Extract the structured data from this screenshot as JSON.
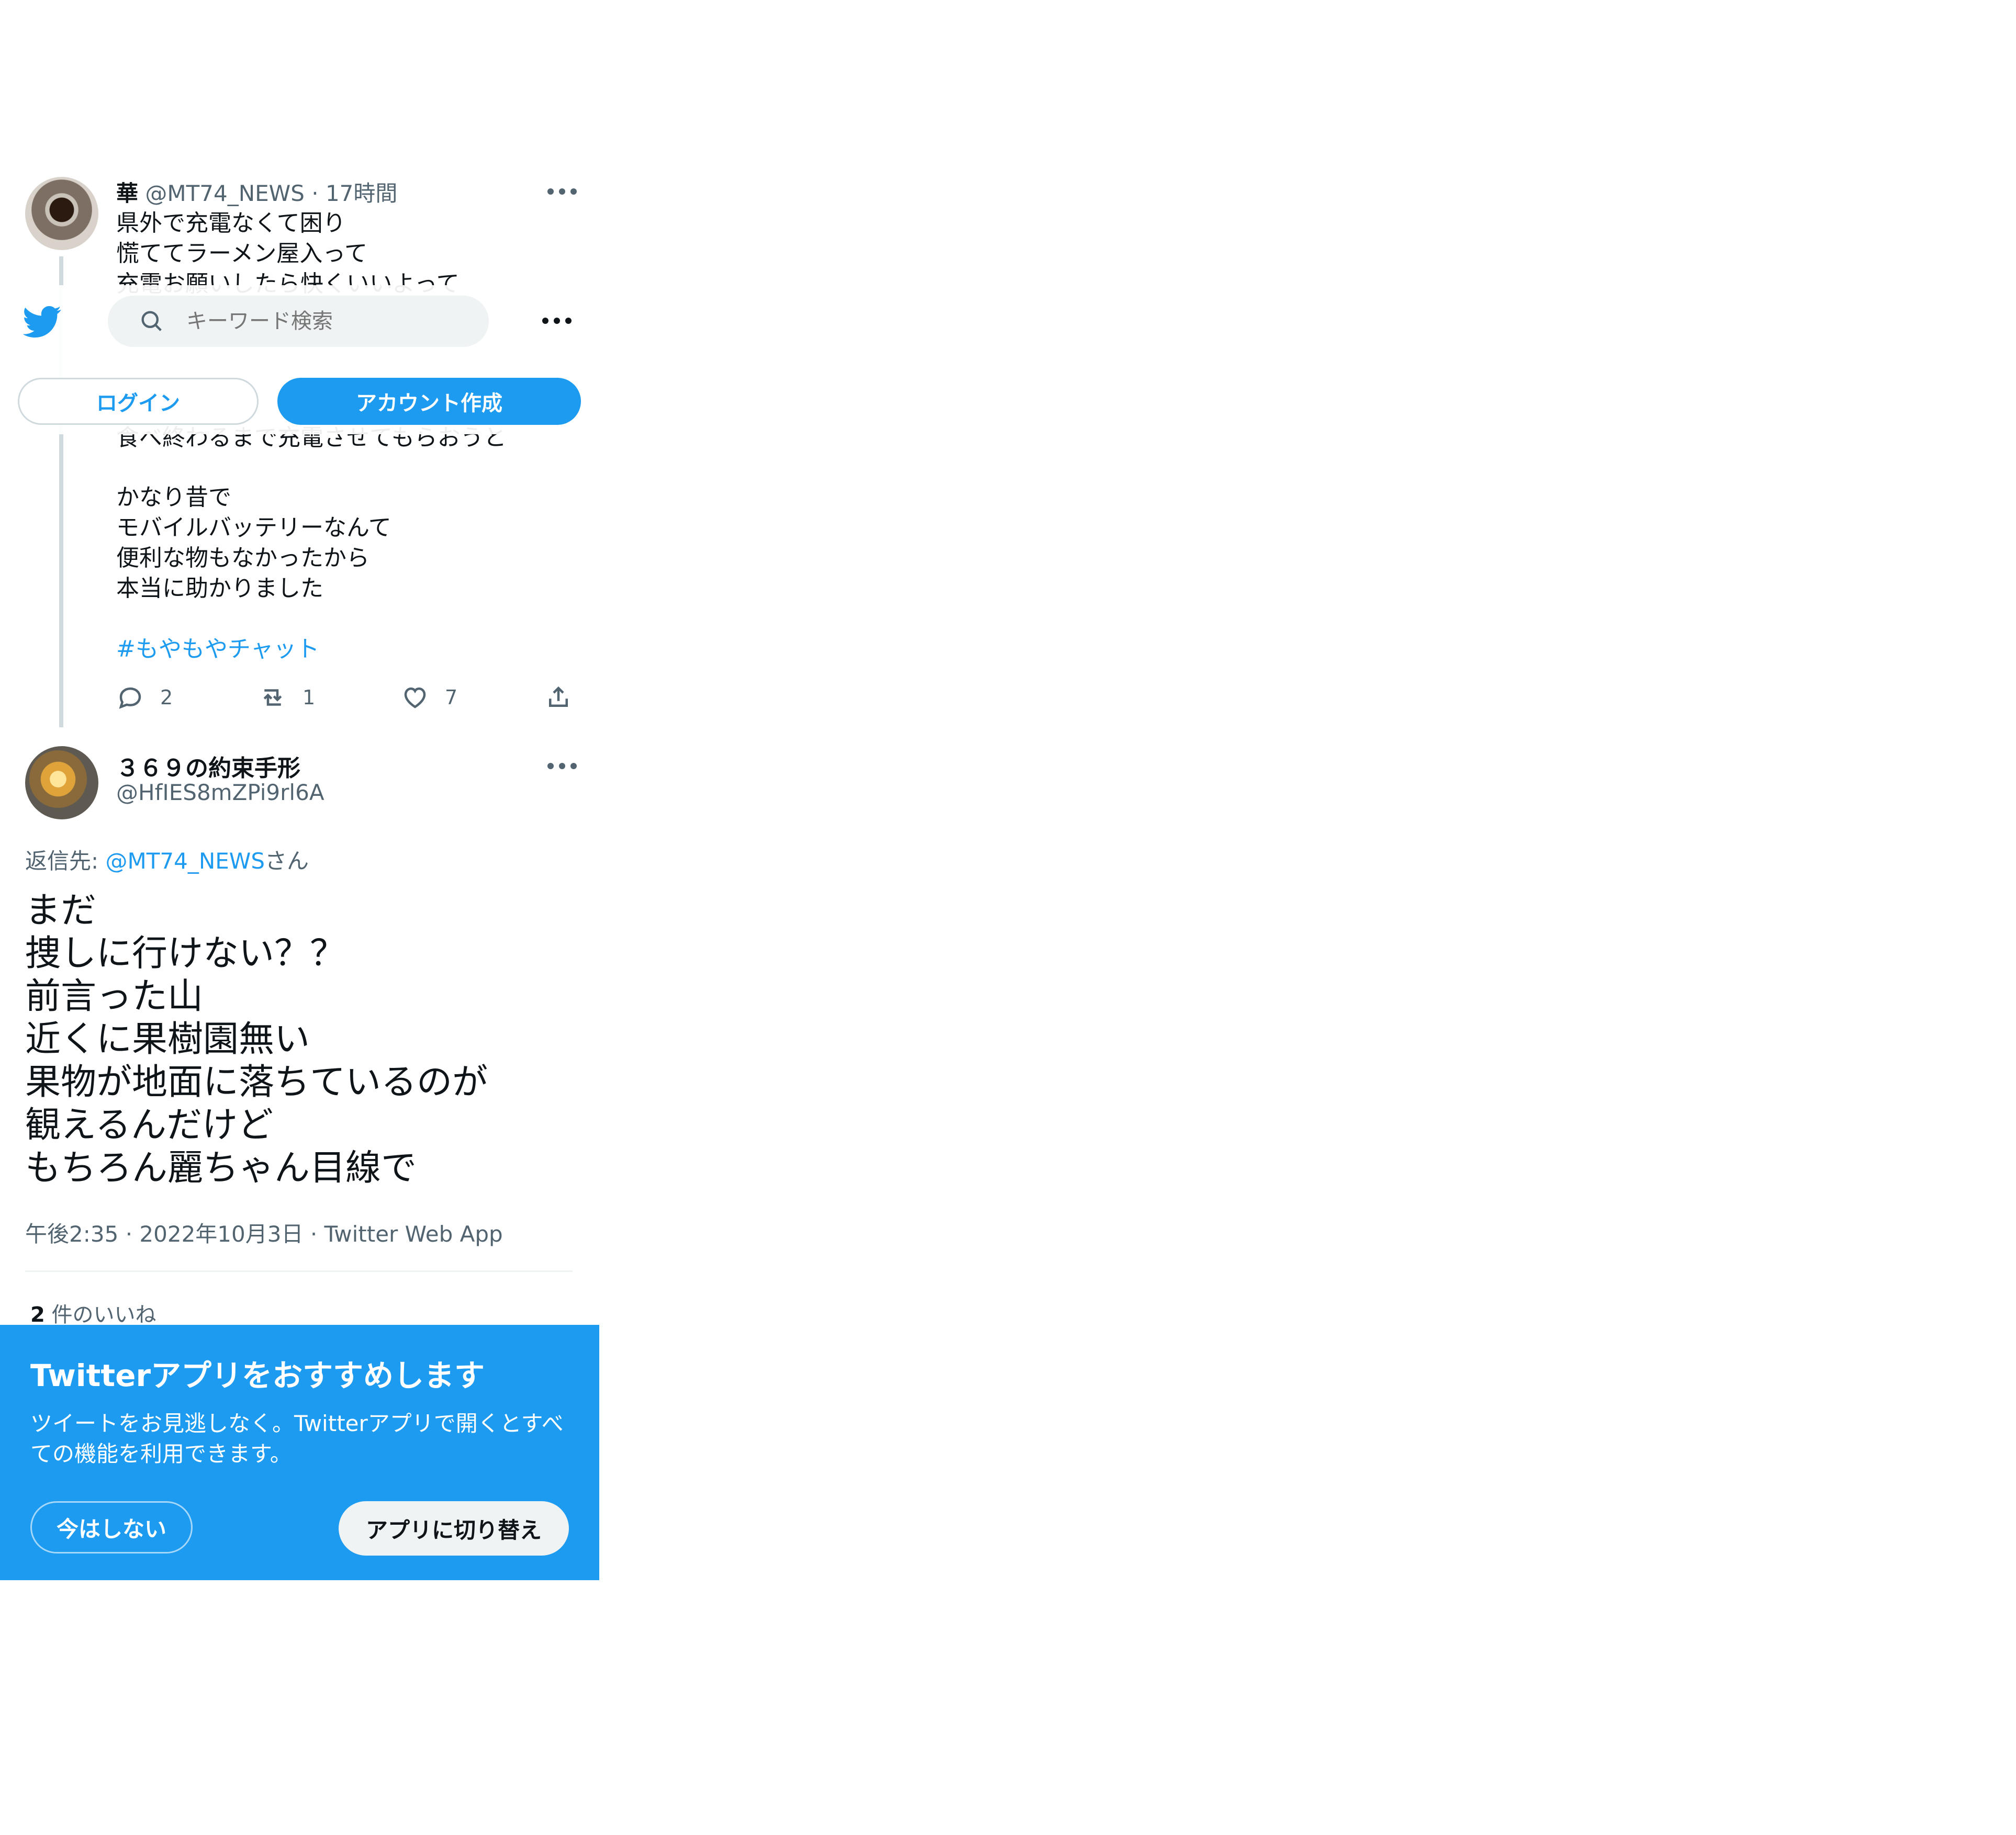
{
  "header": {
    "search_placeholder": "キーワード検索",
    "login_label": "ログイン",
    "signup_label": "アカウント作成"
  },
  "parent_tweet": {
    "author_name": "華",
    "handle": "@MT74_NEWS",
    "separator": "·",
    "time": "17時間",
    "line1": "県外で充電なくて困り",
    "line2": "慌ててラーメン屋入って",
    "line3_partial": "充電お願いしたら快くいいよって",
    "line_obscured": "食べ終わるまで充電させてもらおうと",
    "line4": "かなり昔で",
    "line5": "モバイルバッテリーなんて",
    "line6": "便利な物もなかったから",
    "line7": "本当に助かりました",
    "hashtag": "#もやもやチャット",
    "reply_count": "2",
    "retweet_count": "1",
    "like_count": "7"
  },
  "main_tweet": {
    "author_name": "３６９の約束手形",
    "handle": "@HfIES8mZPi9rl6A",
    "reply_prefix": "返信先: ",
    "reply_to": "@MT74_NEWS",
    "reply_suffix": "さん",
    "lines": [
      "まだ",
      "捜しに行けない？？",
      "前言った山",
      "近くに果樹園無い",
      "果物が地面に落ちているのが",
      "観えるんだけど",
      "もちろん麗ちゃん目線で"
    ],
    "timestamp": "午後2:35",
    "date": "2022年10月3日",
    "source": "Twitter Web App",
    "separator": "·",
    "likes_count": "2",
    "likes_label": " 件のいいね"
  },
  "app_banner": {
    "title": "Twitterアプリをおすすめします",
    "description": "ツイートをお見逃しなく。Twitterアプリで開くとすべての機能を利用できます。",
    "dismiss_label": "今はしない",
    "switch_label": "アプリに切り替え"
  },
  "colors": {
    "accent": "#1d9bf0",
    "banner_bg": "#1d9bf0",
    "muted_text": "#536471",
    "search_bg": "#eff3f4"
  }
}
